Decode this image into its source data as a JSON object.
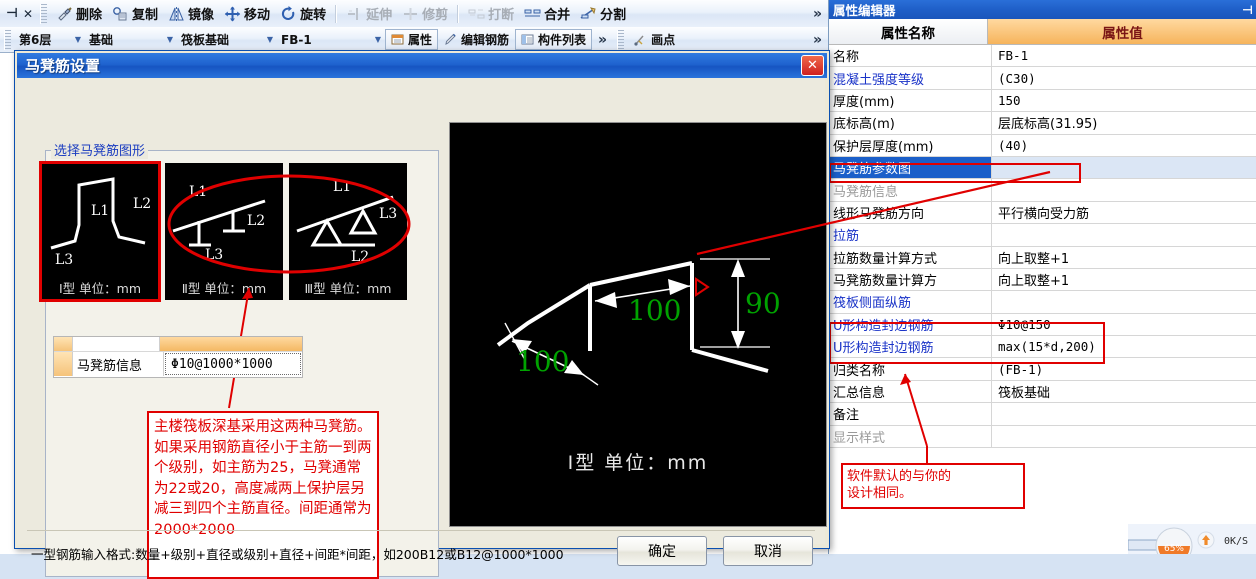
{
  "toolbar": {
    "pin_icon": "pin-icon",
    "close_icon": "close-icon",
    "items": [
      {
        "label": "删除",
        "icon": "eraser-icon",
        "disabled": false
      },
      {
        "label": "复制",
        "icon": "copy-icon",
        "disabled": false
      },
      {
        "label": "镜像",
        "icon": "mirror-icon",
        "disabled": false
      },
      {
        "label": "移动",
        "icon": "move-icon",
        "disabled": false
      },
      {
        "label": "旋转",
        "icon": "rotate-icon",
        "disabled": false
      },
      {
        "label": "延伸",
        "icon": "extend-icon",
        "disabled": true
      },
      {
        "label": "修剪",
        "icon": "trim-icon",
        "disabled": true
      },
      {
        "label": "打断",
        "icon": "break-icon",
        "disabled": true
      },
      {
        "label": "合并",
        "icon": "merge-icon",
        "disabled": false
      },
      {
        "label": "分割",
        "icon": "split-icon",
        "disabled": false
      }
    ],
    "overflow": "»"
  },
  "toolbar2": {
    "combos": [
      {
        "value": "第6层"
      },
      {
        "value": "基础"
      },
      {
        "value": "筏板基础"
      },
      {
        "value": "FB-1"
      }
    ],
    "buttons": [
      {
        "label": "属性",
        "icon": "properties-icon"
      },
      {
        "label": "编辑钢筋",
        "icon": "pencil-icon"
      },
      {
        "label": "构件列表",
        "icon": "list-icon"
      }
    ],
    "overflow": "»",
    "draw_point": {
      "label": "画点",
      "icon": "draw-point-icon"
    },
    "overflow2": "»"
  },
  "property_panel": {
    "title": "属性编辑器",
    "pin_icon": "pin-icon",
    "columns": [
      "属性名称",
      "属性值"
    ],
    "rows": [
      {
        "name": "名称",
        "value": "FB-1",
        "style": "normal"
      },
      {
        "name": "混凝土强度等级",
        "value": "(C30)",
        "style": "blue"
      },
      {
        "name": "厚度(mm)",
        "value": "150",
        "style": "normal"
      },
      {
        "name": "底标高(m)",
        "value": "层底标高(31.95)",
        "style": "normal",
        "cn": true
      },
      {
        "name": "保护层厚度(mm)",
        "value": "(40)",
        "style": "normal"
      },
      {
        "name": "马凳筋参数图",
        "value": "",
        "style": "selected"
      },
      {
        "name": "马凳筋信息",
        "value": "",
        "style": "gray"
      },
      {
        "name": "线形马凳筋方向",
        "value": "平行横向受力筋",
        "style": "normal",
        "cn": true
      },
      {
        "name": "拉筋",
        "value": "",
        "style": "blue"
      },
      {
        "name": "拉筋数量计算方式",
        "value": "向上取整+1",
        "style": "normal",
        "cn": true
      },
      {
        "name": "马凳筋数量计算方",
        "value": "向上取整+1",
        "style": "normal",
        "cn": true
      },
      {
        "name": "筏板侧面纵筋",
        "value": "",
        "style": "blue"
      },
      {
        "name": "U形构造封边钢筋",
        "value": "Φ10@150",
        "style": "blue"
      },
      {
        "name": "U形构造封边钢筋",
        "value": "max(15*d,200)",
        "style": "blue"
      },
      {
        "name": "归类名称",
        "value": "(FB-1)",
        "style": "normal"
      },
      {
        "name": "汇总信息",
        "value": "筏板基础",
        "style": "normal",
        "cn": true
      },
      {
        "name": "备注",
        "value": "",
        "style": "normal"
      },
      {
        "name": "显示样式",
        "value": "",
        "style": "gray"
      }
    ],
    "annotation": "软件默认的与你的\n设计相同。"
  },
  "dialog": {
    "title": "马凳筋设置",
    "close_icon": "close-icon",
    "group_label": "选择马凳筋图形",
    "shapes": [
      {
        "caption": "Ⅰ型 单位：mm",
        "type": "I",
        "selected": true
      },
      {
        "caption": "Ⅱ型 单位：mm",
        "type": "II",
        "selected": false
      },
      {
        "caption": "Ⅲ型 单位：mm",
        "type": "III",
        "selected": false
      }
    ],
    "info_grid": {
      "label": "马凳筋信息",
      "value": "Φ10@1000*1000"
    },
    "preview": {
      "caption": "Ⅰ型 单位：mm",
      "dim_left": "100",
      "dim_mid": "100",
      "dim_right": "90",
      "dim_color": "#00a200"
    },
    "note": "主楼筏板深基采用这两种马凳筋。如果采用钢筋直径小于主筋一到两个级别，如主筋为25，马凳通常为22或20，高度减两上保护层另减三到四个主筋直径。间距通常为2000*2000",
    "hint": "一型钢筋输入格式:数量+级别+直径或级别+直径+间距*间距，如200B12或B12@1000*1000",
    "ok_label": "确定",
    "cancel_label": "取消"
  },
  "download_widget": {
    "percent": "65%",
    "speed": "0K/S",
    "arrow_icon": "up-arrow-icon"
  },
  "colors": {
    "accent_blue": "#1b5fc9",
    "header_orange": "#f4b863",
    "red_markup": "#e00000",
    "dim_green": "#00a200"
  }
}
